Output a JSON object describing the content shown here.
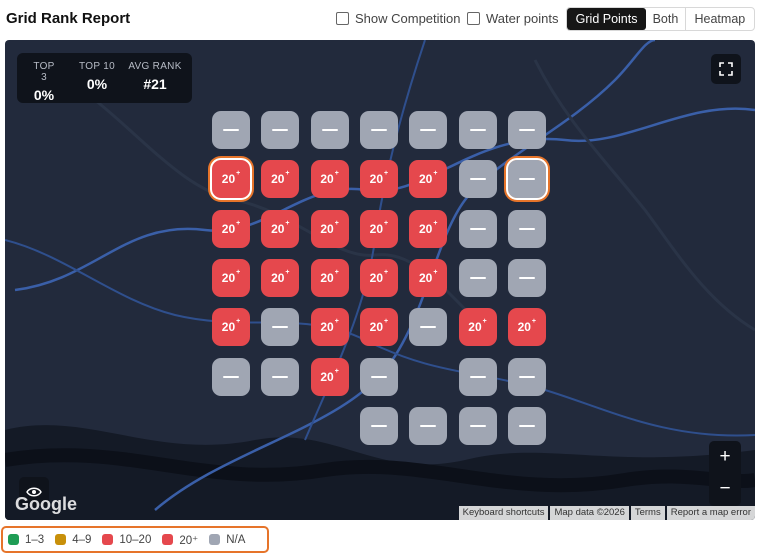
{
  "header": {
    "title": "Grid Rank Report",
    "show_competition": "Show Competition",
    "water_points": "Water points",
    "view_options": [
      "Grid Points",
      "Both",
      "Heatmap"
    ],
    "active_view": "Grid Points"
  },
  "stats": [
    {
      "label": "TOP 3",
      "value": "0%"
    },
    {
      "label": "TOP 10",
      "value": "0%"
    },
    {
      "label": "AVG RANK",
      "value": "#21"
    }
  ],
  "grid": {
    "rank_label": "20",
    "rank_suffix": "+",
    "rows": [
      [
        "na",
        "na",
        "na",
        "na",
        "na",
        "na",
        "na"
      ],
      [
        "20sel",
        "20",
        "20",
        "20",
        "20",
        "na",
        "nasel"
      ],
      [
        "20",
        "20",
        "20",
        "20",
        "20",
        "na",
        "na"
      ],
      [
        "20",
        "20",
        "20",
        "20",
        "20",
        "na",
        "na"
      ],
      [
        "20",
        "na",
        "20",
        "20",
        "na",
        "20",
        "20"
      ],
      [
        "na",
        "na",
        "20",
        "na",
        "",
        "na",
        "na"
      ],
      [
        "",
        "",
        "",
        "na",
        "na",
        "na",
        "na"
      ]
    ]
  },
  "map": {
    "logo": "Google",
    "attribution": [
      "Keyboard shortcuts",
      "Map data ©2026",
      "Terms",
      "Report a map error"
    ],
    "zoom_in": "+",
    "zoom_out": "−"
  },
  "legend": [
    {
      "label": "1–3",
      "color": "#1f9d55"
    },
    {
      "label": "4–9",
      "color": "#c8900a"
    },
    {
      "label": "10–20",
      "color": "#e5484d"
    },
    {
      "label": "20⁺",
      "color": "#e5484d"
    },
    {
      "label": "N/A",
      "color": "#a0a6b3"
    }
  ]
}
